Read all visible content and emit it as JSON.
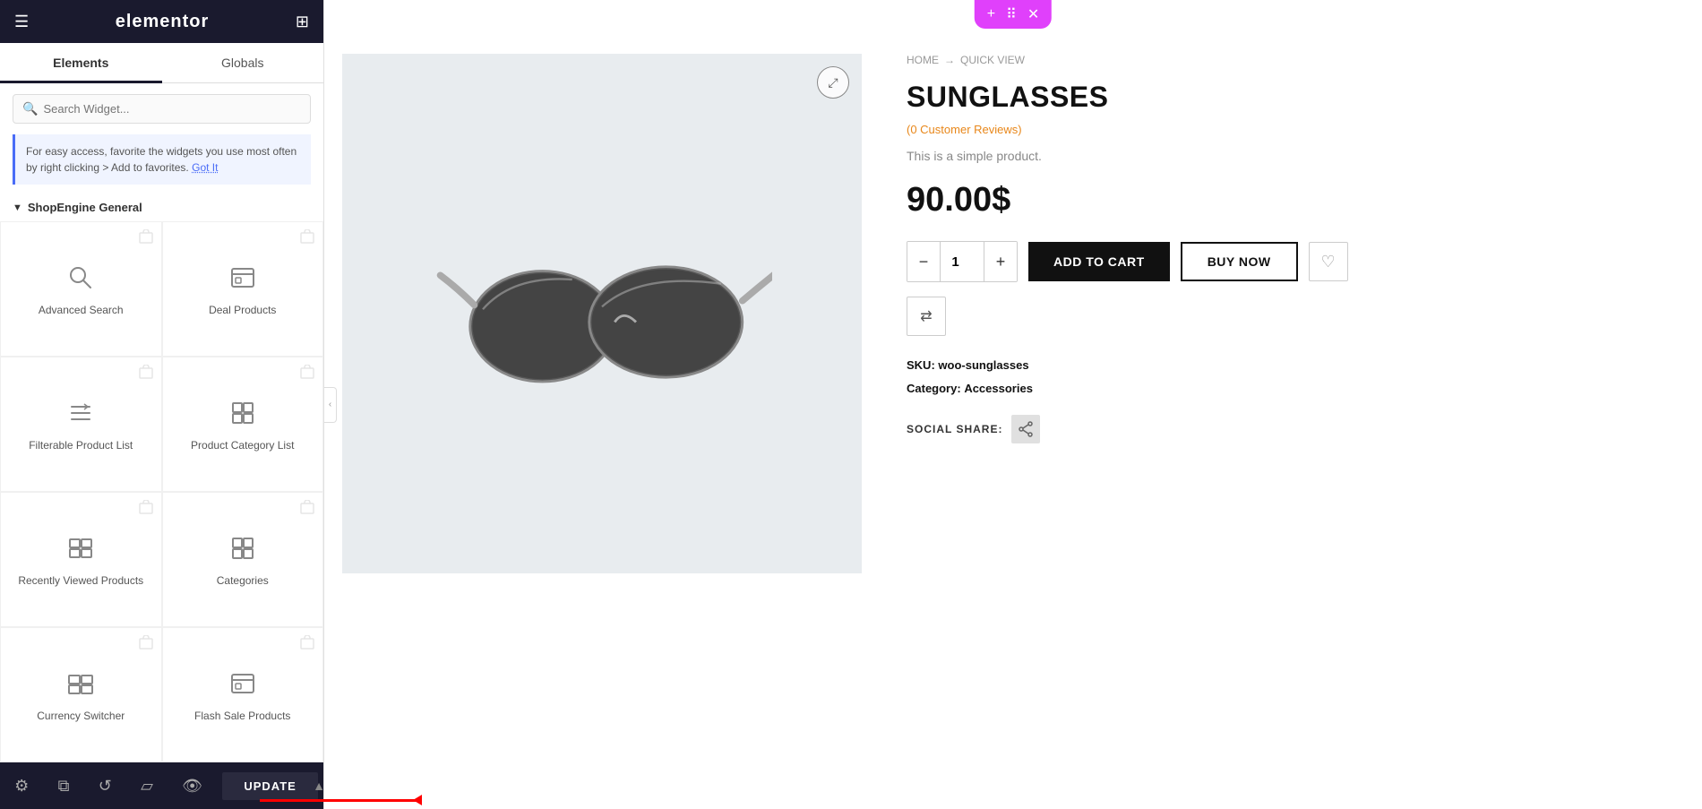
{
  "app": {
    "title": "elementor",
    "menu_icon": "☰",
    "grid_icon": "⊞"
  },
  "tabs": {
    "elements": "Elements",
    "globals": "Globals",
    "active": "elements"
  },
  "search": {
    "placeholder": "Search Widget..."
  },
  "info_box": {
    "text": "For easy access, favorite the widgets you use most often by right clicking > Add to favorites.",
    "link_text": "Got It"
  },
  "section": {
    "title": "ShopEngine General"
  },
  "widgets": [
    {
      "id": "advanced-search",
      "label": "Advanced Search",
      "icon": "🔍"
    },
    {
      "id": "deal-products",
      "label": "Deal Products",
      "icon": "🗃"
    },
    {
      "id": "filterable-product-list",
      "label": "Filterable Product List",
      "icon": "≡↓"
    },
    {
      "id": "product-category-list",
      "label": "Product Category List",
      "icon": "🧊"
    },
    {
      "id": "recently-viewed-products",
      "label": "Recently Viewed Products",
      "icon": "⧉"
    },
    {
      "id": "categories",
      "label": "Categories",
      "icon": "🧊"
    },
    {
      "id": "currency-switcher",
      "label": "Currency Switcher",
      "icon": "⧉"
    },
    {
      "id": "flash-sale-products",
      "label": "Flash Sale Products",
      "icon": "🗃"
    }
  ],
  "bottom_toolbar": {
    "settings_icon": "⚙",
    "layers_icon": "⧉",
    "history_icon": "↺",
    "responsive_icon": "▱",
    "preview_icon": "👁",
    "update_label": "UPDATE",
    "arrow_icon": "▲"
  },
  "top_controls": {
    "plus": "+",
    "grid": "⠿",
    "close": "✕"
  },
  "breadcrumb": {
    "home": "HOME",
    "separator": "→",
    "current": "QUICK VIEW"
  },
  "product": {
    "title": "SUNGLASSES",
    "reviews": "(0 Customer Reviews)",
    "description": "This is a simple product.",
    "price": "90.00$",
    "qty": "1",
    "add_to_cart": "ADD TO CART",
    "buy_now": "BUY NOW",
    "sku_label": "SKU:",
    "sku_value": "woo-sunglasses",
    "category_label": "Category:",
    "category_value": "Accessories",
    "social_share_label": "SOCIAL SHARE:"
  },
  "colors": {
    "dark_bg": "#1a1a2e",
    "accent_pink": "#e040fb",
    "price_color": "#111111",
    "add_cart_bg": "#111111",
    "tab_active_indicator": "#1a1a2e"
  }
}
